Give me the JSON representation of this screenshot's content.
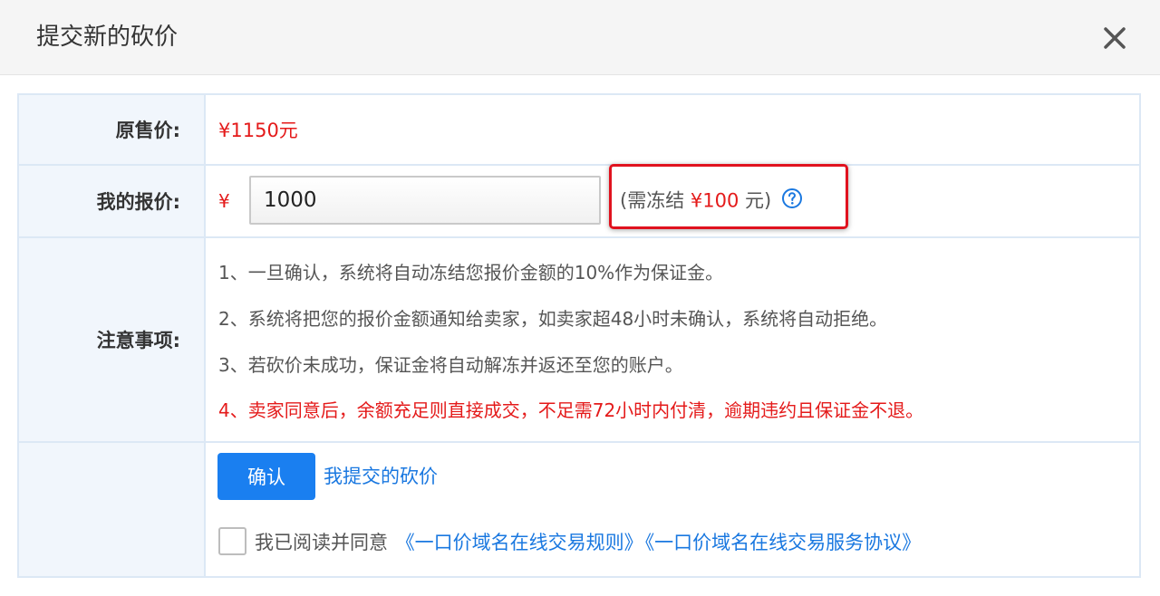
{
  "dialog": {
    "title": "提交新的砍价"
  },
  "rows": {
    "original_price": {
      "label": "原售价:",
      "value": "¥1150元"
    },
    "my_offer": {
      "label": "我的报价:",
      "currency": "¥",
      "input_value": "1000",
      "freeze_prefix": "(需冻结",
      "freeze_amount": "¥100",
      "freeze_suffix": "元)"
    },
    "notice": {
      "label": "注意事项:",
      "items": [
        "1、一旦确认，系统将自动冻结您报价金额的10%作为保证金。",
        "2、系统将把您的报价金额通知给卖家，如卖家超48小时未确认，系统将自动拒绝。",
        "3、若砍价未成功，保证金将自动解冻并返还至您的账户。",
        "4、卖家同意后，余额充足则直接成交，不足需72小时内付清，逾期违约且保证金不退。"
      ]
    },
    "actions": {
      "confirm_label": "确认",
      "my_offers_link": "我提交的砍价",
      "agree_prefix": "我已阅读并同意",
      "rules_link": "《一口价域名在线交易规则》",
      "agreement_link": "《一口价域名在线交易服务协议》"
    }
  },
  "icons": {
    "close": "close-icon",
    "help": "help-icon"
  },
  "colors": {
    "accent_blue": "#1a7ff0",
    "link_blue": "#1a78e0",
    "price_red": "#e41a1a",
    "highlight_red": "#e0121e",
    "label_bg": "#f1f6fc",
    "border": "#dce8f5"
  }
}
